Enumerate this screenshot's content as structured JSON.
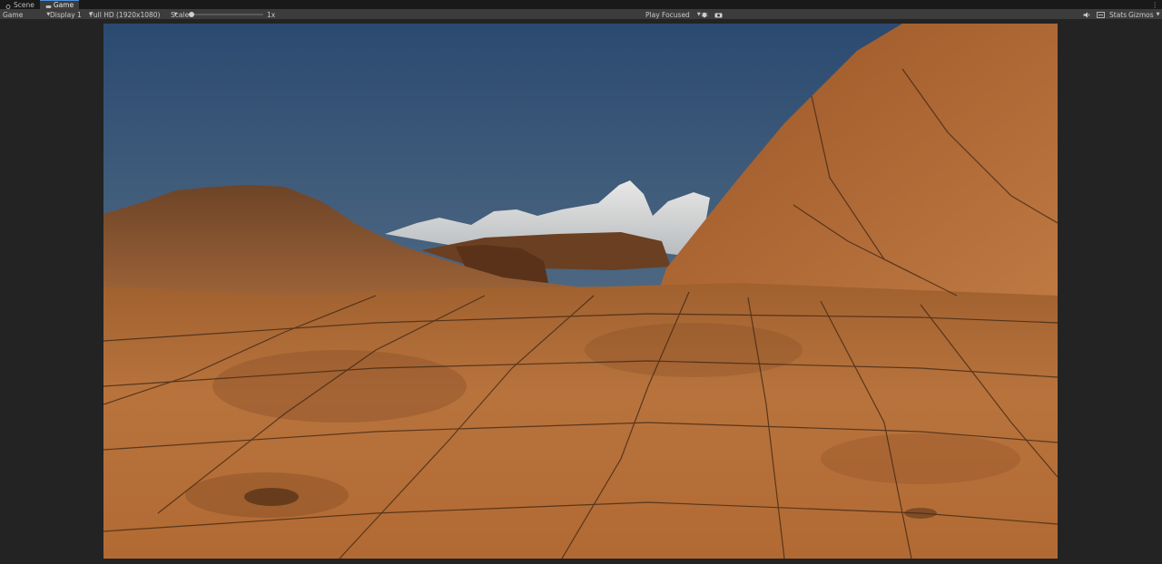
{
  "tabs": [
    {
      "label": "Scene",
      "icon": "scene-icon"
    },
    {
      "label": "Game",
      "icon": "gamepad-icon"
    }
  ],
  "toolbar": {
    "view_mode": "Game",
    "display": "Display 1",
    "resolution": "Full HD (1920x1080)",
    "scale_label": "Scale",
    "scale_value": "1x",
    "play_mode": "Play Focused",
    "stats_label": "Stats",
    "gizmos_label": "Gizmos"
  },
  "icons": {
    "more": "vertical-ellipsis-icon",
    "bug": "bug-icon",
    "camera": "camera-icon",
    "audio": "speaker-icon",
    "layout": "display-icon"
  },
  "colors": {
    "accent": "#4a90d9",
    "sky_top": "#2b4a70",
    "sky_bottom": "#6f8594",
    "ground": "#b56a34"
  }
}
